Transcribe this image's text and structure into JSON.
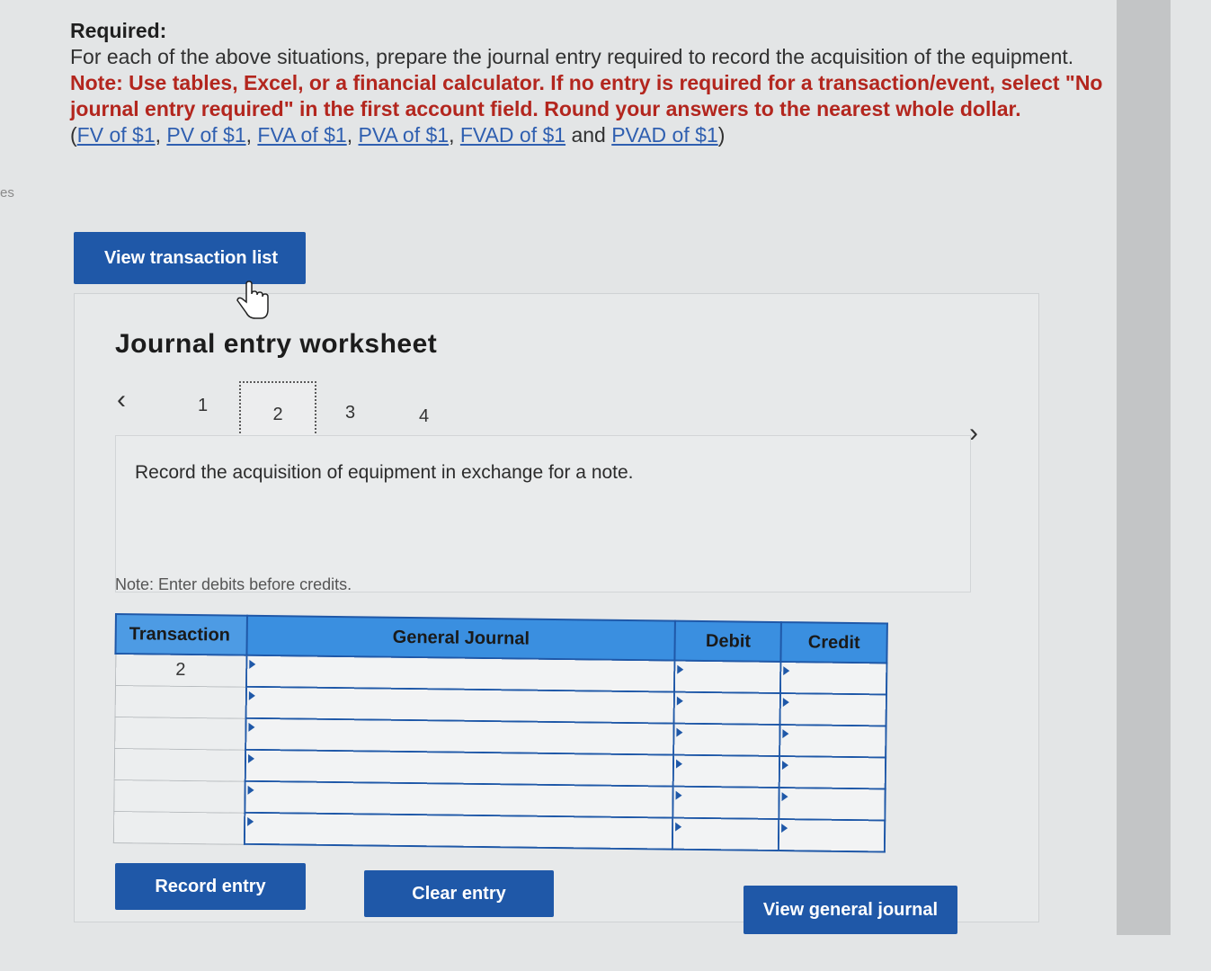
{
  "edge_text": "es",
  "instructions": {
    "required_label": "Required:",
    "text": "For each of the above situations, prepare the journal entry required to record the acquisition of the equipment.",
    "note": "Note: Use tables, Excel, or a financial calculator. If no entry is required for a transaction/event, select \"No journal entry required\" in the first account field. Round your answers to the nearest whole dollar.",
    "links": [
      "FV of $1",
      "PV of $1",
      "FVA of $1",
      "PVA of $1",
      "FVAD of $1",
      "PVAD of $1"
    ],
    "and": "and"
  },
  "buttons": {
    "view_transaction_list": "View transaction list",
    "record_entry": "Record entry",
    "clear_entry": "Clear entry",
    "view_general_journal": "View general journal"
  },
  "worksheet": {
    "title": "Journal entry worksheet",
    "pages": [
      "1",
      "2",
      "3",
      "4"
    ],
    "current_page": "2",
    "description": "Record the acquisition of equipment in exchange for a note.",
    "note": "Note: Enter debits before credits."
  },
  "journal_table": {
    "headers": [
      "Transaction",
      "General Journal",
      "Debit",
      "Credit"
    ],
    "rows": [
      {
        "transaction": "2",
        "account": "",
        "debit": "",
        "credit": ""
      },
      {
        "transaction": "",
        "account": "",
        "debit": "",
        "credit": ""
      },
      {
        "transaction": "",
        "account": "",
        "debit": "",
        "credit": ""
      },
      {
        "transaction": "",
        "account": "",
        "debit": "",
        "credit": ""
      },
      {
        "transaction": "",
        "account": "",
        "debit": "",
        "credit": ""
      },
      {
        "transaction": "",
        "account": "",
        "debit": "",
        "credit": ""
      }
    ]
  },
  "colors": {
    "button_blue": "#1f58a8",
    "header_blue": "#3a8fe0",
    "note_red": "#b3261e",
    "link_blue": "#2f5fb0"
  }
}
